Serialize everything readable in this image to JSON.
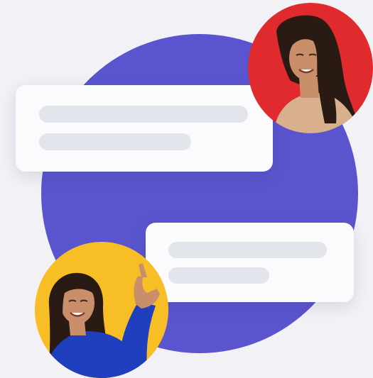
{
  "colors": {
    "background": "#f1f1f6",
    "accent_circle": "#5a55cf",
    "bubble": "#fbfbfd",
    "placeholder_line": "#e3e5ec",
    "avatar_top_bg": "#e02a2d",
    "avatar_bottom_bg": "#f7bf25",
    "sweater_blue": "#1f3fbf",
    "hair": "#2a1a14",
    "skin": "#c98f6b"
  },
  "icons": {
    "avatar_top": "woman-with-long-dark-hair-avatar",
    "avatar_bottom": "woman-in-blue-sweater-pointing-avatar"
  },
  "chat": {
    "messages": [
      {
        "side": "left",
        "line_count": 2
      },
      {
        "side": "right",
        "line_count": 2
      }
    ]
  }
}
